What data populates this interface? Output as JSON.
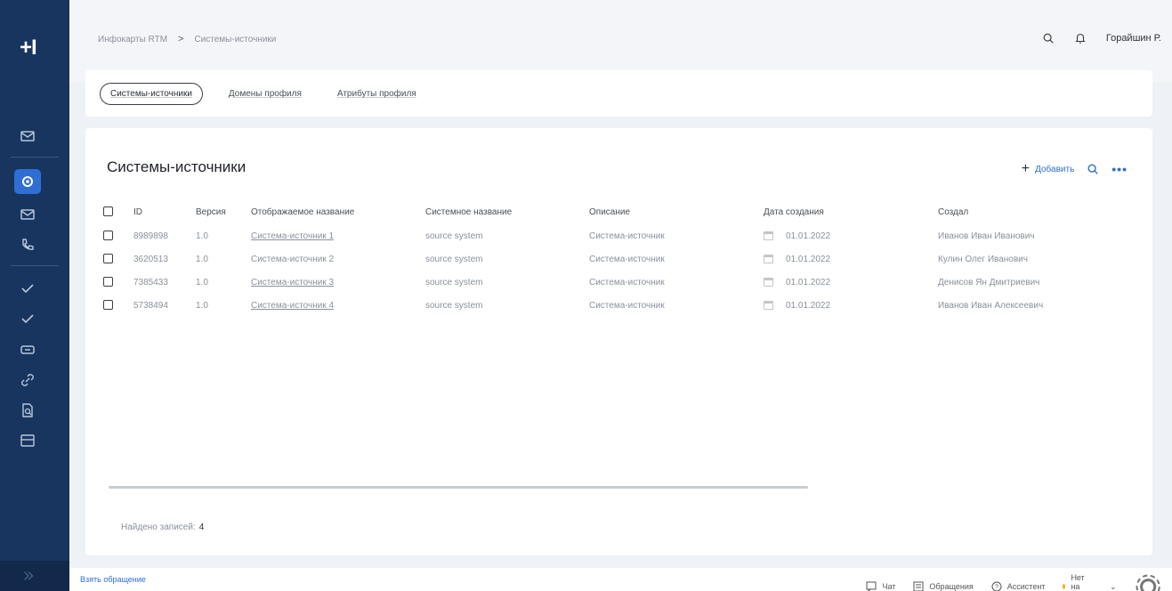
{
  "app": {
    "logo": "+I"
  },
  "sidebar": {
    "icons": [
      "mail-icon",
      "settings-icon",
      "mail-icon",
      "phone-icon",
      "check-icon",
      "check-icon",
      "ticket-icon",
      "link-icon",
      "document-search-icon",
      "table-icon"
    ],
    "active_index": 1
  },
  "breadcrumb": {
    "items": [
      "Инфокарты RTM",
      "Системы-источники"
    ],
    "separator": ">"
  },
  "header": {
    "user_name": "Горайшин Р."
  },
  "tabs": [
    {
      "label": "Системы-источники",
      "active": true
    },
    {
      "label": "Домены профиля",
      "active": false
    },
    {
      "label": "Атрибуты профиля",
      "active": false
    }
  ],
  "card": {
    "title": "Системы-источники",
    "add_label": "Добавить",
    "more_label": "•••"
  },
  "table": {
    "columns": [
      "ID",
      "Версия",
      "Отображаемое название",
      "Системное название",
      "Описание",
      "Дата создания",
      "Создал"
    ],
    "rows": [
      {
        "id": "8989898",
        "version": "1.0",
        "display_name": "Система-источник 1",
        "system_name": "source system",
        "description": "Система-источник",
        "created": "01.01.2022",
        "author": "Иванов Иван Иванович",
        "linked": true
      },
      {
        "id": "3620513",
        "version": "1.0",
        "display_name": "Система-источник 2",
        "system_name": "source system",
        "description": "Система-источник",
        "created": "01.01.2022",
        "author": "Кулин Олег Иванович",
        "linked": false
      },
      {
        "id": "7385433",
        "version": "1.0",
        "display_name": "Система-источник 3",
        "system_name": "source system",
        "description": "Система-источник",
        "created": "01.01.2022",
        "author": "Денисов Ян Дмитриевич",
        "linked": true
      },
      {
        "id": "5738494",
        "version": "1.0",
        "display_name": "Система-источник 4",
        "system_name": "source system",
        "description": "Система-источник",
        "created": "01.01.2022",
        "author": "Иванов Иван Алексеевич",
        "linked": true
      }
    ]
  },
  "footer": {
    "found_label": "Найдено записей:",
    "found_count": "4"
  },
  "statusbar": {
    "left_link": "Взять обращение",
    "chat": "Чат",
    "requests": "Обращения",
    "assistant": "Ассистент",
    "status": "Нет на месте",
    "status_color": "#e8b710"
  },
  "colors": {
    "sidebar": "#17355f",
    "accent": "#2f6ed4"
  }
}
